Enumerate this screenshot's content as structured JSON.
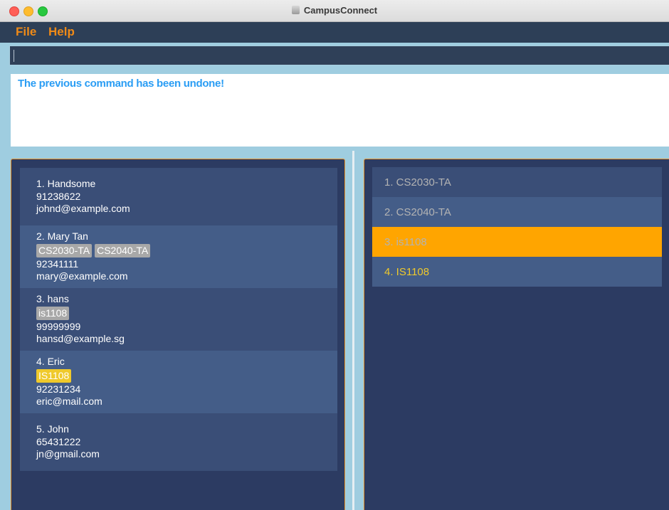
{
  "window": {
    "title": "CampusConnect"
  },
  "menu": {
    "file": "File",
    "help": "Help"
  },
  "command": {
    "value": ""
  },
  "result": {
    "message": "The previous command has been undone!"
  },
  "persons": [
    {
      "index": "1.",
      "name": "Handsome",
      "tags": [],
      "phone": "91238622",
      "email": "johnd@example.com"
    },
    {
      "index": "2.",
      "name": "Mary Tan",
      "tags": [
        "CS2030-TA",
        "CS2040-TA"
      ],
      "phone": "92341111",
      "email": "mary@example.com"
    },
    {
      "index": "3.",
      "name": "hans",
      "tags": [
        "is1108"
      ],
      "phone": "99999999",
      "email": "hansd@example.sg"
    },
    {
      "index": "4.",
      "name": "Eric",
      "tags": [
        "IS1108"
      ],
      "phone": "92231234",
      "email": "eric@mail.com"
    },
    {
      "index": "5.",
      "name": "John",
      "tags": [],
      "phone": "65431222",
      "email": "jn@gmail.com"
    }
  ],
  "tag_list": [
    {
      "label": "1. CS2030-TA",
      "color": "#b3b3b3",
      "selected": false
    },
    {
      "label": "2. CS2040-TA",
      "color": "#b3b3b3",
      "selected": false
    },
    {
      "label": "3. is1108",
      "color": "#b3b3b3",
      "selected": true
    },
    {
      "label": "4. IS1108",
      "color": "#efc92b",
      "selected": false
    }
  ],
  "colors": {
    "accent": "#ef8a17",
    "result_text": "#2a9df4",
    "selected_row": "#ffa500",
    "highlight_tag": "#efc92b"
  }
}
